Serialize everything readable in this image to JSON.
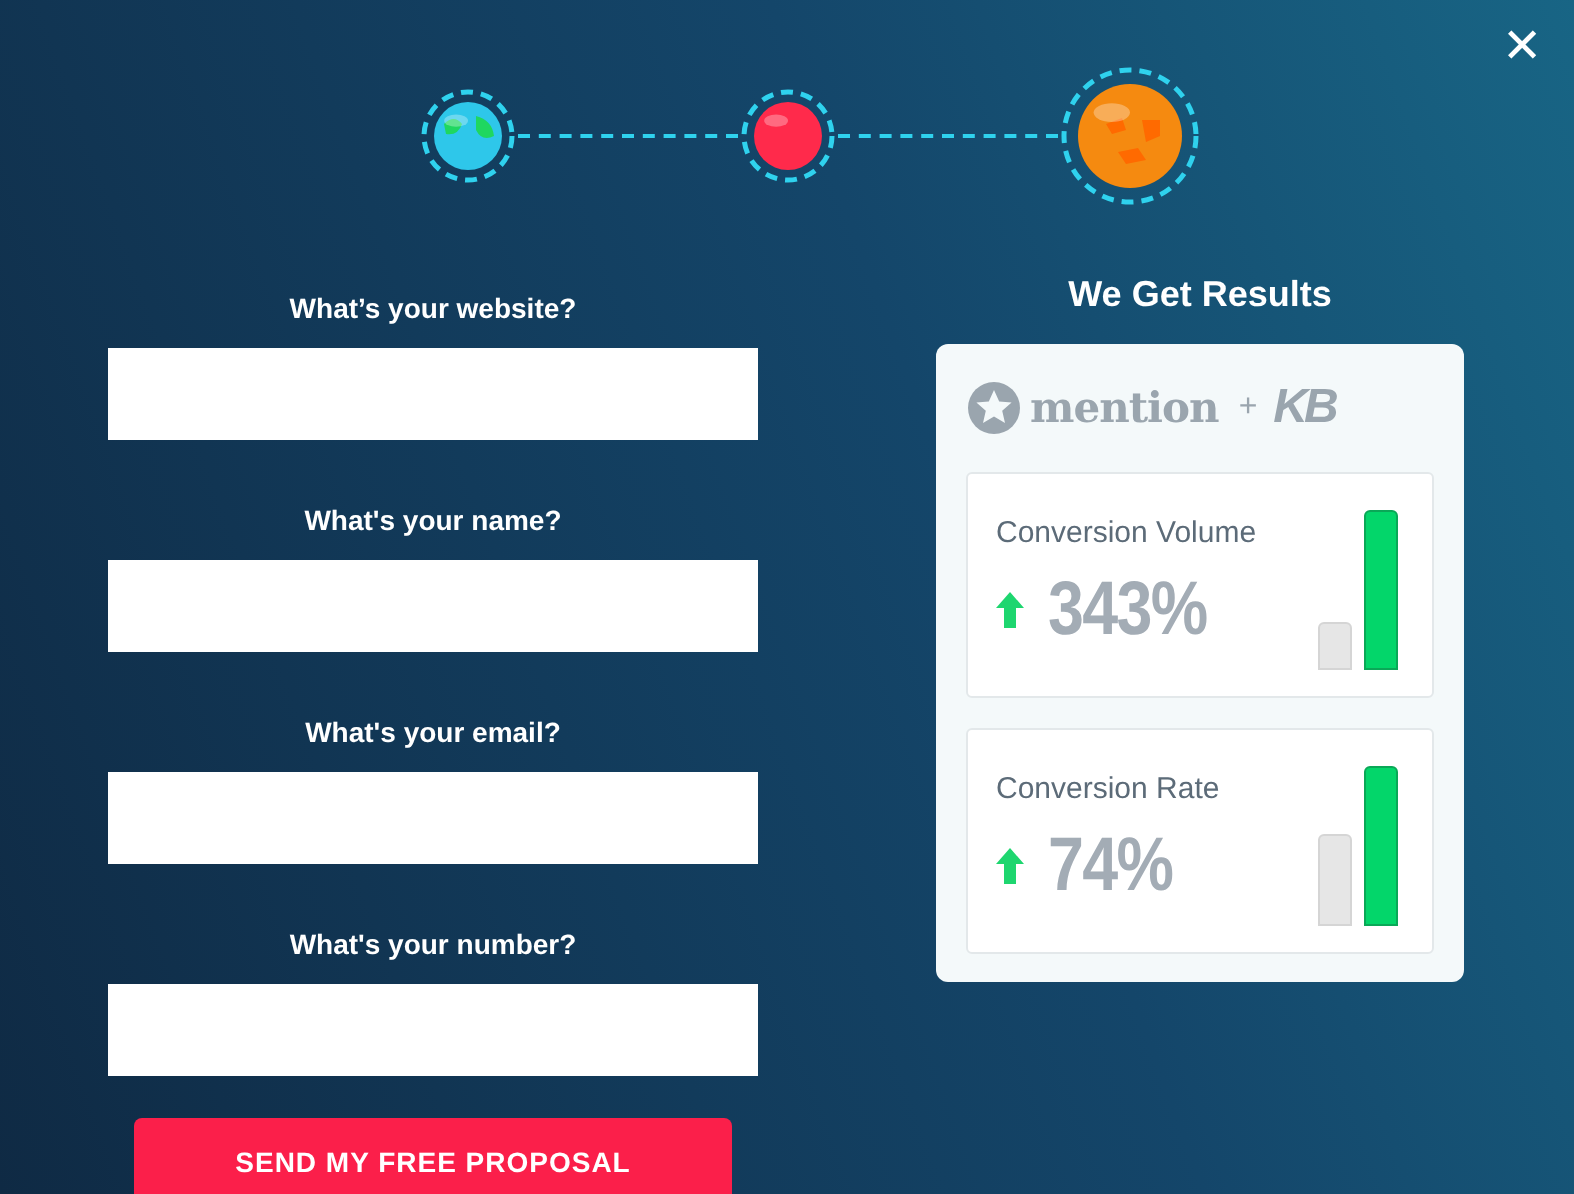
{
  "close_label": "✕",
  "steps": [
    {
      "kind": "earth",
      "selected": false
    },
    {
      "kind": "red",
      "selected": false
    },
    {
      "kind": "mars",
      "selected": true
    }
  ],
  "form": {
    "fields": [
      {
        "label": "What’s your website?"
      },
      {
        "label": "What's your name?"
      },
      {
        "label": "What's your email?"
      },
      {
        "label": "What's your number?"
      }
    ],
    "submit": "SEND MY FREE PROPOSAL"
  },
  "results": {
    "title": "We Get Results",
    "brand": "mention",
    "plus": "+",
    "partner": "KB",
    "stats": [
      {
        "label": "Conversion Volume",
        "value": "343%"
      },
      {
        "label": "Conversion Rate",
        "value": "74%"
      }
    ]
  }
}
